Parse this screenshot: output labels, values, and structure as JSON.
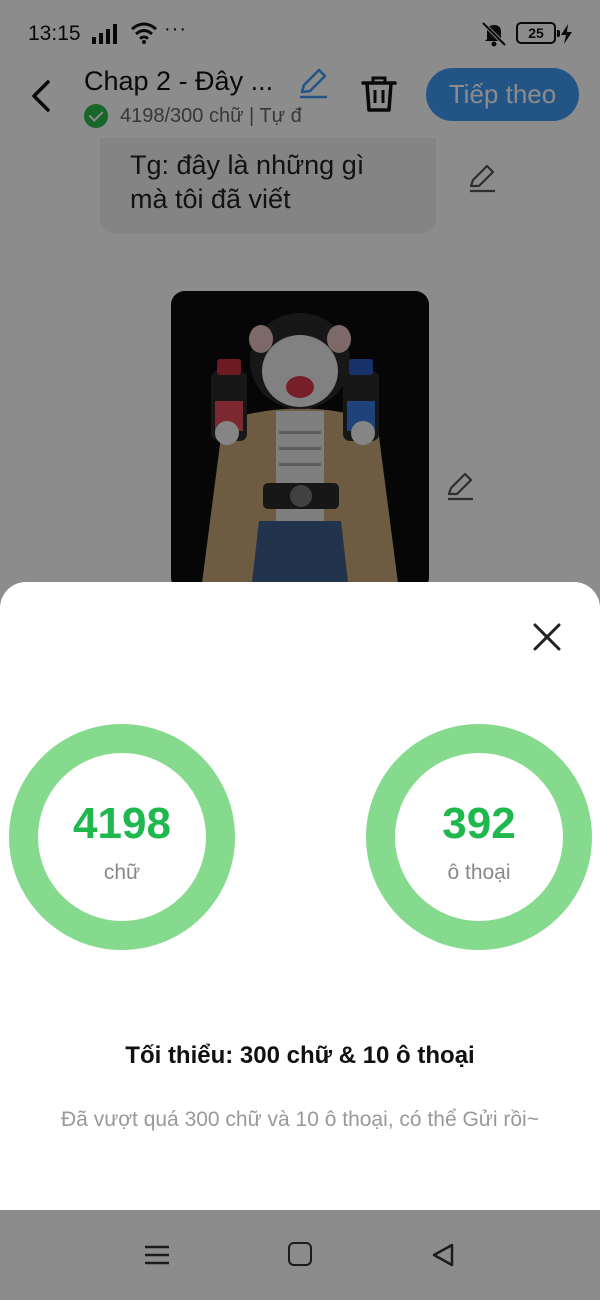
{
  "status_bar": {
    "time": "13:15",
    "more": "···",
    "battery": "25"
  },
  "header": {
    "title": "Chap 2 - Đây ...",
    "subtitle": "4198/300 chữ | Tự đ",
    "next_button": "Tiếp theo"
  },
  "content": {
    "message_line1": "Tg: đây là những gì",
    "message_line2": "mà tôi đã viết"
  },
  "sheet": {
    "words": {
      "value": "4198",
      "label": "chữ"
    },
    "dialogs": {
      "value": "392",
      "label": "ô thoại"
    },
    "minimum": "Tối thiểu: 300 chữ & 10 ô thoại",
    "note": "Đã vượt quá 300 chữ và 10 ô thoại, có thể Gửi rồi~"
  },
  "colors": {
    "accent_blue": "#3f9af5",
    "ring_green": "#86da8e",
    "value_green": "#1fb84c"
  },
  "icons": [
    "signal-icon",
    "wifi-icon",
    "mute-icon",
    "battery-icon",
    "charging-icon",
    "back-arrow-icon",
    "pencil-icon",
    "trash-icon",
    "close-icon",
    "menu-icon",
    "home-icon",
    "nav-back-icon",
    "check-icon"
  ]
}
